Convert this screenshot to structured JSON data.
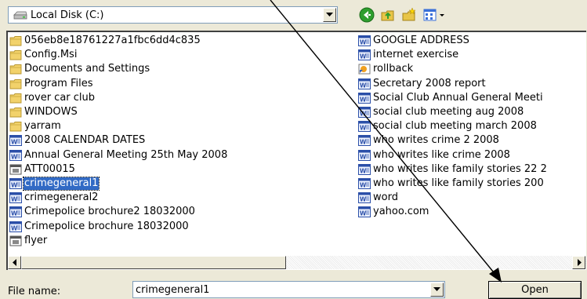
{
  "look_in": {
    "value": "Local Disk (C:)",
    "icon": "drive-icon"
  },
  "toolbar": {
    "buttons": [
      {
        "name": "back-icon",
        "color": "#2e9e2e"
      },
      {
        "name": "up-folder-icon",
        "color": "#e8c547"
      },
      {
        "name": "new-folder-icon",
        "color": "#e8c547"
      },
      {
        "name": "view-menu-icon",
        "color": "#3a6fd8"
      }
    ]
  },
  "files": {
    "left": [
      {
        "name": "056eb8e18761227a1fbc6dd4c835",
        "icon": "folder-icon"
      },
      {
        "name": "Config.Msi",
        "icon": "folder-icon"
      },
      {
        "name": "Documents and Settings",
        "icon": "folder-icon"
      },
      {
        "name": "Program Files",
        "icon": "folder-icon"
      },
      {
        "name": "rover car club",
        "icon": "folder-icon"
      },
      {
        "name": "WINDOWS",
        "icon": "folder-icon"
      },
      {
        "name": "yarram",
        "icon": "folder-icon"
      },
      {
        "name": "2008 CALENDAR DATES",
        "icon": "word-doc-icon"
      },
      {
        "name": "Annual General Meeting 25th May 2008",
        "icon": "word-doc-icon"
      },
      {
        "name": "ATT00015",
        "icon": "generic-file-icon"
      },
      {
        "name": "crimegeneral1",
        "icon": "word-doc-icon",
        "selected": true
      },
      {
        "name": "crimegeneral2",
        "icon": "word-doc-icon"
      },
      {
        "name": "Crimepolice brochure2 18032000",
        "icon": "word-doc-icon"
      },
      {
        "name": "Crimepolice brochure 18032000",
        "icon": "word-doc-icon"
      },
      {
        "name": "flyer",
        "icon": "generic-file-icon"
      }
    ],
    "right": [
      {
        "name": "GOOGLE ADDRESS",
        "icon": "word-doc-icon"
      },
      {
        "name": "internet exercise",
        "icon": "word-doc-icon"
      },
      {
        "name": "rollback",
        "icon": "shortcut-icon"
      },
      {
        "name": "Secretary 2008 report",
        "icon": "word-doc-icon"
      },
      {
        "name": "Social Club Annual General Meeti",
        "icon": "word-doc-icon"
      },
      {
        "name": "social club meeting aug 2008",
        "icon": "word-doc-icon"
      },
      {
        "name": "social club meeting march 2008",
        "icon": "word-doc-icon"
      },
      {
        "name": "who writes crime 2 2008",
        "icon": "word-doc-icon"
      },
      {
        "name": "who writes like crime 2008",
        "icon": "word-doc-icon"
      },
      {
        "name": "who writes like family stories 22 2",
        "icon": "word-doc-icon"
      },
      {
        "name": "who writes like family stories 200",
        "icon": "word-doc-icon"
      },
      {
        "name": "word",
        "icon": "word-doc-icon"
      },
      {
        "name": "yahoo.com",
        "icon": "word-doc-icon"
      }
    ]
  },
  "bottom": {
    "filename_label": "File name:",
    "filename_value": "crimegeneral1",
    "open_label": "Open"
  },
  "colors": {
    "selection": "#316ac5",
    "dialog_bg": "#ece9d8",
    "arrow": "#000000"
  }
}
